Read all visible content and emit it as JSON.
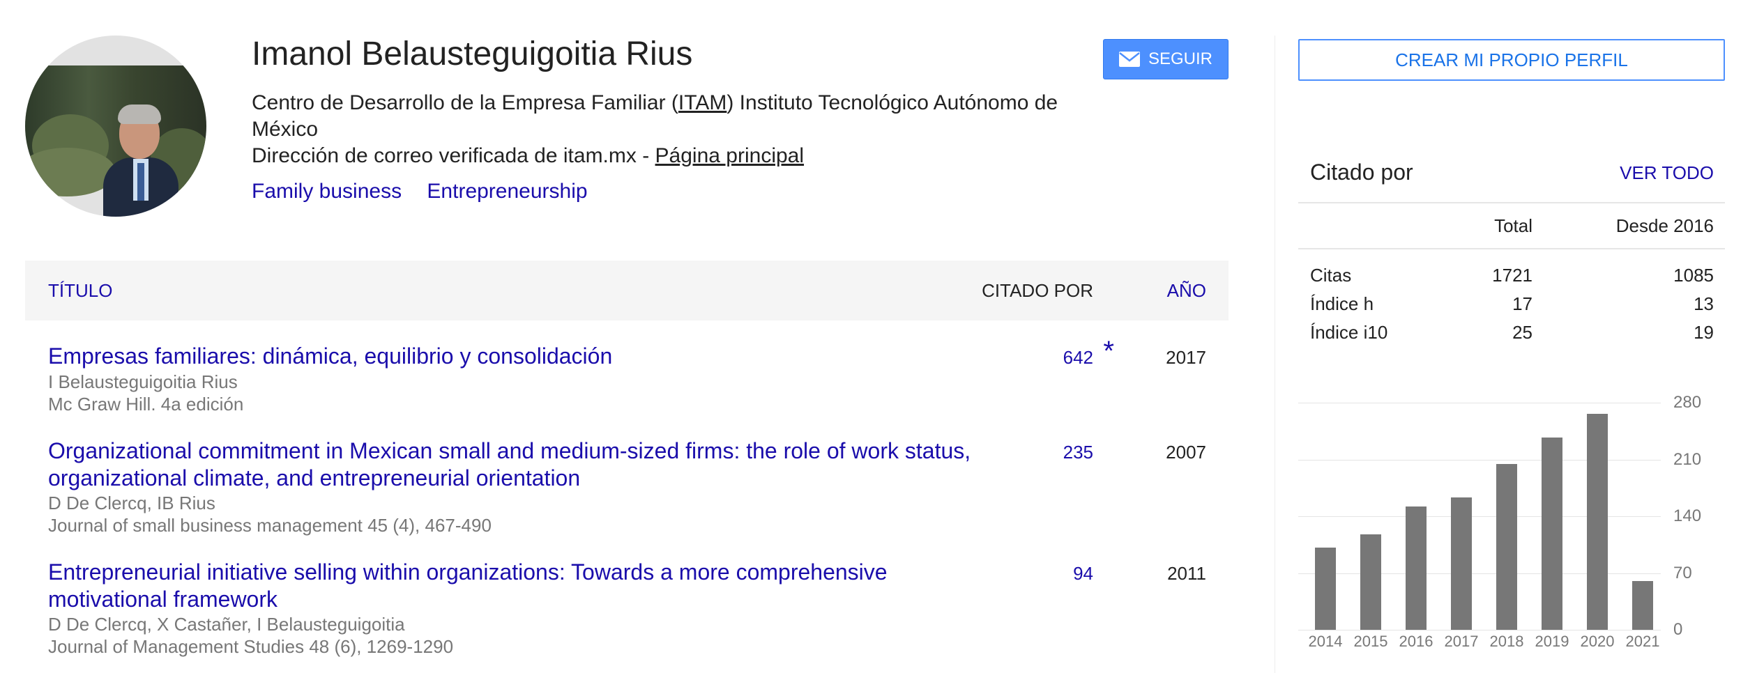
{
  "profile": {
    "name": "Imanol Belausteguigoitia Rius",
    "affiliation_prefix": "Centro de Desarrollo de la Empresa Familiar (",
    "affiliation_link": "ITAM",
    "affiliation_suffix": ") Instituto Tecnológico Autónomo de México",
    "email_text": "Dirección de correo verificada de itam.mx - ",
    "homepage_link": "Página principal",
    "interests": [
      "Family business",
      "Entrepreneurship"
    ],
    "follow_label": "SEGUIR"
  },
  "table": {
    "headers": {
      "title": "TÍTULO",
      "cited_by": "CITADO POR",
      "year": "AÑO"
    },
    "rows": [
      {
        "title": "Empresas familiares: dinámica, equilibrio y consolidación",
        "authors": "I Belausteguigoitia Rius",
        "venue": "Mc Graw Hill. 4a edición",
        "cited": "642",
        "star": "*",
        "year": "2017"
      },
      {
        "title": "Organizational commitment in Mexican small and medium-sized firms: the role of work status, organizational climate, and entrepreneurial orientation",
        "authors": "D De Clercq, IB Rius",
        "venue": "Journal of small business management 45 (4), 467-490",
        "cited": "235",
        "year": "2007"
      },
      {
        "title": "Entrepreneurial initiative selling within organizations: Towards a more comprehensive motivational framework",
        "authors": "D De Clercq, X Castañer, I Belausteguigoitia",
        "venue": "Journal of Management Studies 48 (6), 1269-1290",
        "cited": "94",
        "year": "2011"
      }
    ]
  },
  "sidebar": {
    "create_profile_label": "CREAR MI PROPIO PERFIL",
    "cited_by_title": "Citado por",
    "view_all_label": "VER TODO",
    "stats_headers": {
      "total": "Total",
      "since": "Desde 2016"
    },
    "stats": [
      {
        "label": "Citas",
        "total": "1721",
        "since": "1085"
      },
      {
        "label": "Índice h",
        "total": "17",
        "since": "13"
      },
      {
        "label": "Índice i10",
        "total": "25",
        "since": "19"
      }
    ]
  },
  "chart_data": {
    "type": "bar",
    "categories": [
      "2014",
      "2015",
      "2016",
      "2017",
      "2018",
      "2019",
      "2020",
      "2021"
    ],
    "values": [
      101,
      118,
      152,
      163,
      204,
      237,
      266,
      60
    ],
    "yticks": [
      0,
      70,
      140,
      210,
      280
    ],
    "ylim": [
      0,
      280
    ],
    "grid": true,
    "bar_color": "#777777"
  },
  "colors": {
    "link": "#1a0dab",
    "button": "#4d90fe",
    "muted": "#777777"
  },
  "icons": {
    "follow": "mail-icon"
  }
}
